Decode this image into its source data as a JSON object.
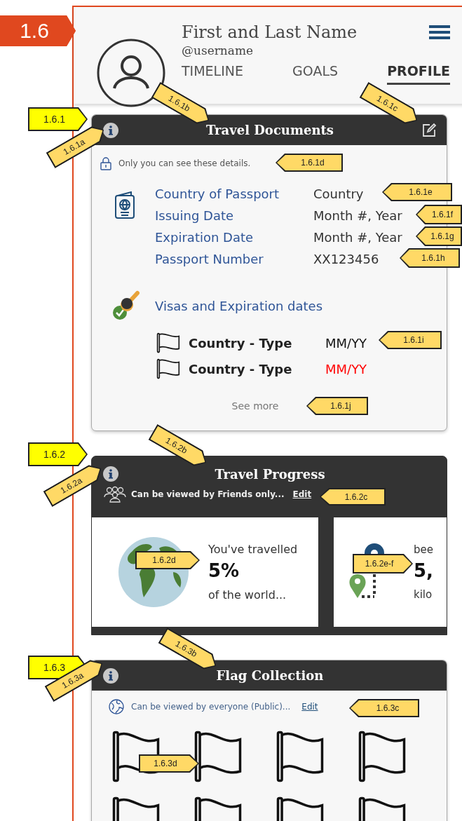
{
  "header": {
    "name": "First and Last Name",
    "username": "@username",
    "tabs": [
      {
        "label": "TIMELINE",
        "selected": false
      },
      {
        "label": "GOALS",
        "selected": false
      },
      {
        "label": "PROFILE",
        "selected": true
      }
    ]
  },
  "travel_documents": {
    "title": "Travel Documents",
    "privacy_note": "Only you can see these details.",
    "passport_fields": [
      {
        "label": "Country of Passport",
        "value": "Country"
      },
      {
        "label": "Issuing Date",
        "value": "Month #, Year"
      },
      {
        "label": "Expiration Date",
        "value": "Month #, Year"
      },
      {
        "label": "Passport Number",
        "value": "XX123456"
      }
    ],
    "visas_heading": "Visas and Expiration dates",
    "visas": [
      {
        "name": "Country - Type",
        "expiry": "MM/YY",
        "expired": false
      },
      {
        "name": "Country - Type",
        "expiry": "MM/YY",
        "expired": true
      }
    ],
    "see_more": "See more"
  },
  "travel_progress": {
    "title": "Travel Progress",
    "privacy_note": "Can be viewed by Friends only...",
    "edit_link": "Edit",
    "stats": [
      {
        "kind": "world",
        "line_1": "You've travelled",
        "value": "5%",
        "line_2": "of the world..."
      },
      {
        "kind": "distance",
        "line_1": "bee",
        "value": "5,",
        "line_2": "kilo"
      }
    ]
  },
  "flag_collection": {
    "title": "Flag Collection",
    "privacy_note": "Can be viewed by everyone (Public)...",
    "edit_link": "Edit"
  },
  "callouts": [
    {
      "label": "1.6",
      "kind": "page"
    },
    {
      "label": "1.6.1b",
      "kind": "element"
    },
    {
      "label": "1.6.1c",
      "kind": "element"
    },
    {
      "label": "1.6.1",
      "kind": "section"
    },
    {
      "label": "1.6.1a",
      "kind": "element"
    },
    {
      "label": "1.6.1d",
      "kind": "element"
    },
    {
      "label": "1.6.1e",
      "kind": "element"
    },
    {
      "label": "1.6.1f",
      "kind": "element"
    },
    {
      "label": "1.6.1g",
      "kind": "element"
    },
    {
      "label": "1.6.1h",
      "kind": "element"
    },
    {
      "label": "1.6.1i",
      "kind": "element"
    },
    {
      "label": "1.6.1j",
      "kind": "element"
    },
    {
      "label": "1.6.2b",
      "kind": "element"
    },
    {
      "label": "1.6.2",
      "kind": "section"
    },
    {
      "label": "1.6.2a",
      "kind": "element"
    },
    {
      "label": "1.6.2c",
      "kind": "element"
    },
    {
      "label": "1.6.2d",
      "kind": "element"
    },
    {
      "label": "1.6.2e-f",
      "kind": "element"
    },
    {
      "label": "1.6.3b",
      "kind": "element"
    },
    {
      "label": "1.6.3",
      "kind": "section"
    },
    {
      "label": "1.6.3a",
      "kind": "element"
    },
    {
      "label": "1.6.3c",
      "kind": "element"
    },
    {
      "label": "1.6.3d",
      "kind": "element"
    }
  ]
}
